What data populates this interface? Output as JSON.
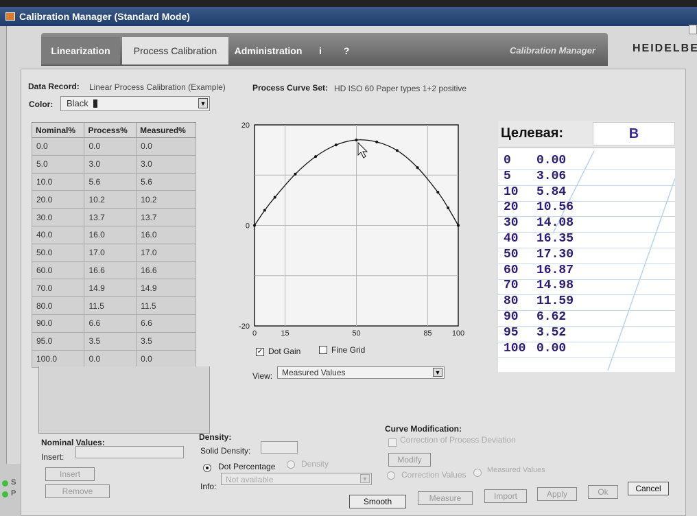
{
  "window": {
    "title": "Calibration Manager (Standard Mode)"
  },
  "tabs": [
    {
      "label": "Linearization"
    },
    {
      "label": "Process Calibration"
    },
    {
      "label": "Administration"
    },
    {
      "label": "i"
    },
    {
      "label": "?"
    }
  ],
  "brand": {
    "product_label": "Calibration Manager",
    "vendor_label": "HEIDELBE"
  },
  "record": {
    "data_record_label": "Data Record:",
    "data_record_value": "Linear Process Calibration (Example)",
    "curve_set_label": "Process Curve Set:",
    "curve_set_value": "HD ISO 60 Paper types 1+2 positive"
  },
  "color": {
    "label": "Color:",
    "selected": "Black"
  },
  "table": {
    "headers": [
      "Nominal%",
      "Process%",
      "Measured%"
    ],
    "rows": [
      [
        "0.0",
        "0.0",
        "0.0"
      ],
      [
        "5.0",
        "3.0",
        "3.0"
      ],
      [
        "10.0",
        "5.6",
        "5.6"
      ],
      [
        "20.0",
        "10.2",
        "10.2"
      ],
      [
        "30.0",
        "13.7",
        "13.7"
      ],
      [
        "40.0",
        "16.0",
        "16.0"
      ],
      [
        "50.0",
        "17.0",
        "17.0"
      ],
      [
        "60.0",
        "16.6",
        "16.6"
      ],
      [
        "70.0",
        "14.9",
        "14.9"
      ],
      [
        "80.0",
        "11.5",
        "11.5"
      ],
      [
        "90.0",
        "6.6",
        "6.6"
      ],
      [
        "95.0",
        "3.5",
        "3.5"
      ],
      [
        "100.0",
        "0.0",
        "0.0"
      ]
    ]
  },
  "chart_data": {
    "type": "line",
    "x": [
      0,
      5,
      10,
      20,
      30,
      40,
      50,
      60,
      70,
      80,
      90,
      95,
      100
    ],
    "series": [
      {
        "values": [
          0.0,
          3.0,
          5.6,
          10.2,
          13.7,
          16.0,
          17.0,
          16.6,
          14.9,
          11.5,
          6.6,
          3.5,
          0.0
        ]
      }
    ],
    "xlim": [
      0,
      100
    ],
    "ylim": [
      -20,
      20
    ],
    "x_ticks": [
      "0",
      "15",
      "50",
      "85",
      "100"
    ],
    "y_ticks": [
      "20",
      "0",
      "-20"
    ],
    "grid": true,
    "title": "",
    "xlabel": "",
    "ylabel": ""
  },
  "chart_options": {
    "dot_gain_label": "Dot Gain",
    "dot_gain_checked": true,
    "fine_grid_label": "Fine Grid",
    "fine_grid_checked": false
  },
  "view": {
    "label": "View:",
    "selected": "Measured Values"
  },
  "nominal_values": {
    "heading": "Nominal Values:",
    "insert_label": "Insert:",
    "insert_button": "Insert",
    "remove_button": "Remove"
  },
  "density": {
    "heading": "Density:",
    "solid_density_label": "Solid Density:",
    "dot_percentage_label": "Dot Percentage",
    "density_label": "Density",
    "info_label": "Info:",
    "info_value": "Not available"
  },
  "curve_modification": {
    "heading": "Curve Modification:",
    "correction_label": "Correction of Process Deviation",
    "modify_button": "Modify",
    "correction_values_label": "Correction Values",
    "measured_values_label": "Measured Values"
  },
  "actions": {
    "smooth": "Smooth",
    "measure": "Measure",
    "import": "Import",
    "apply": "Apply",
    "ok": "Ok",
    "cancel": "Cancel"
  },
  "status": {
    "s_label": "S",
    "p_label": "P"
  },
  "overlay": {
    "title": "Целевая:",
    "box_value": "B",
    "rows": [
      [
        "0",
        "0.00"
      ],
      [
        "5",
        "3.06"
      ],
      [
        "10",
        "5.84"
      ],
      [
        "20",
        "10.56"
      ],
      [
        "30",
        "14.08"
      ],
      [
        "40",
        "16.35"
      ],
      [
        "50",
        "17.30"
      ],
      [
        "60",
        "16.87"
      ],
      [
        "70",
        "14.98"
      ],
      [
        "80",
        "11.59"
      ],
      [
        "90",
        "6.62"
      ],
      [
        "95",
        "3.52"
      ],
      [
        "100",
        "0.00"
      ]
    ]
  }
}
